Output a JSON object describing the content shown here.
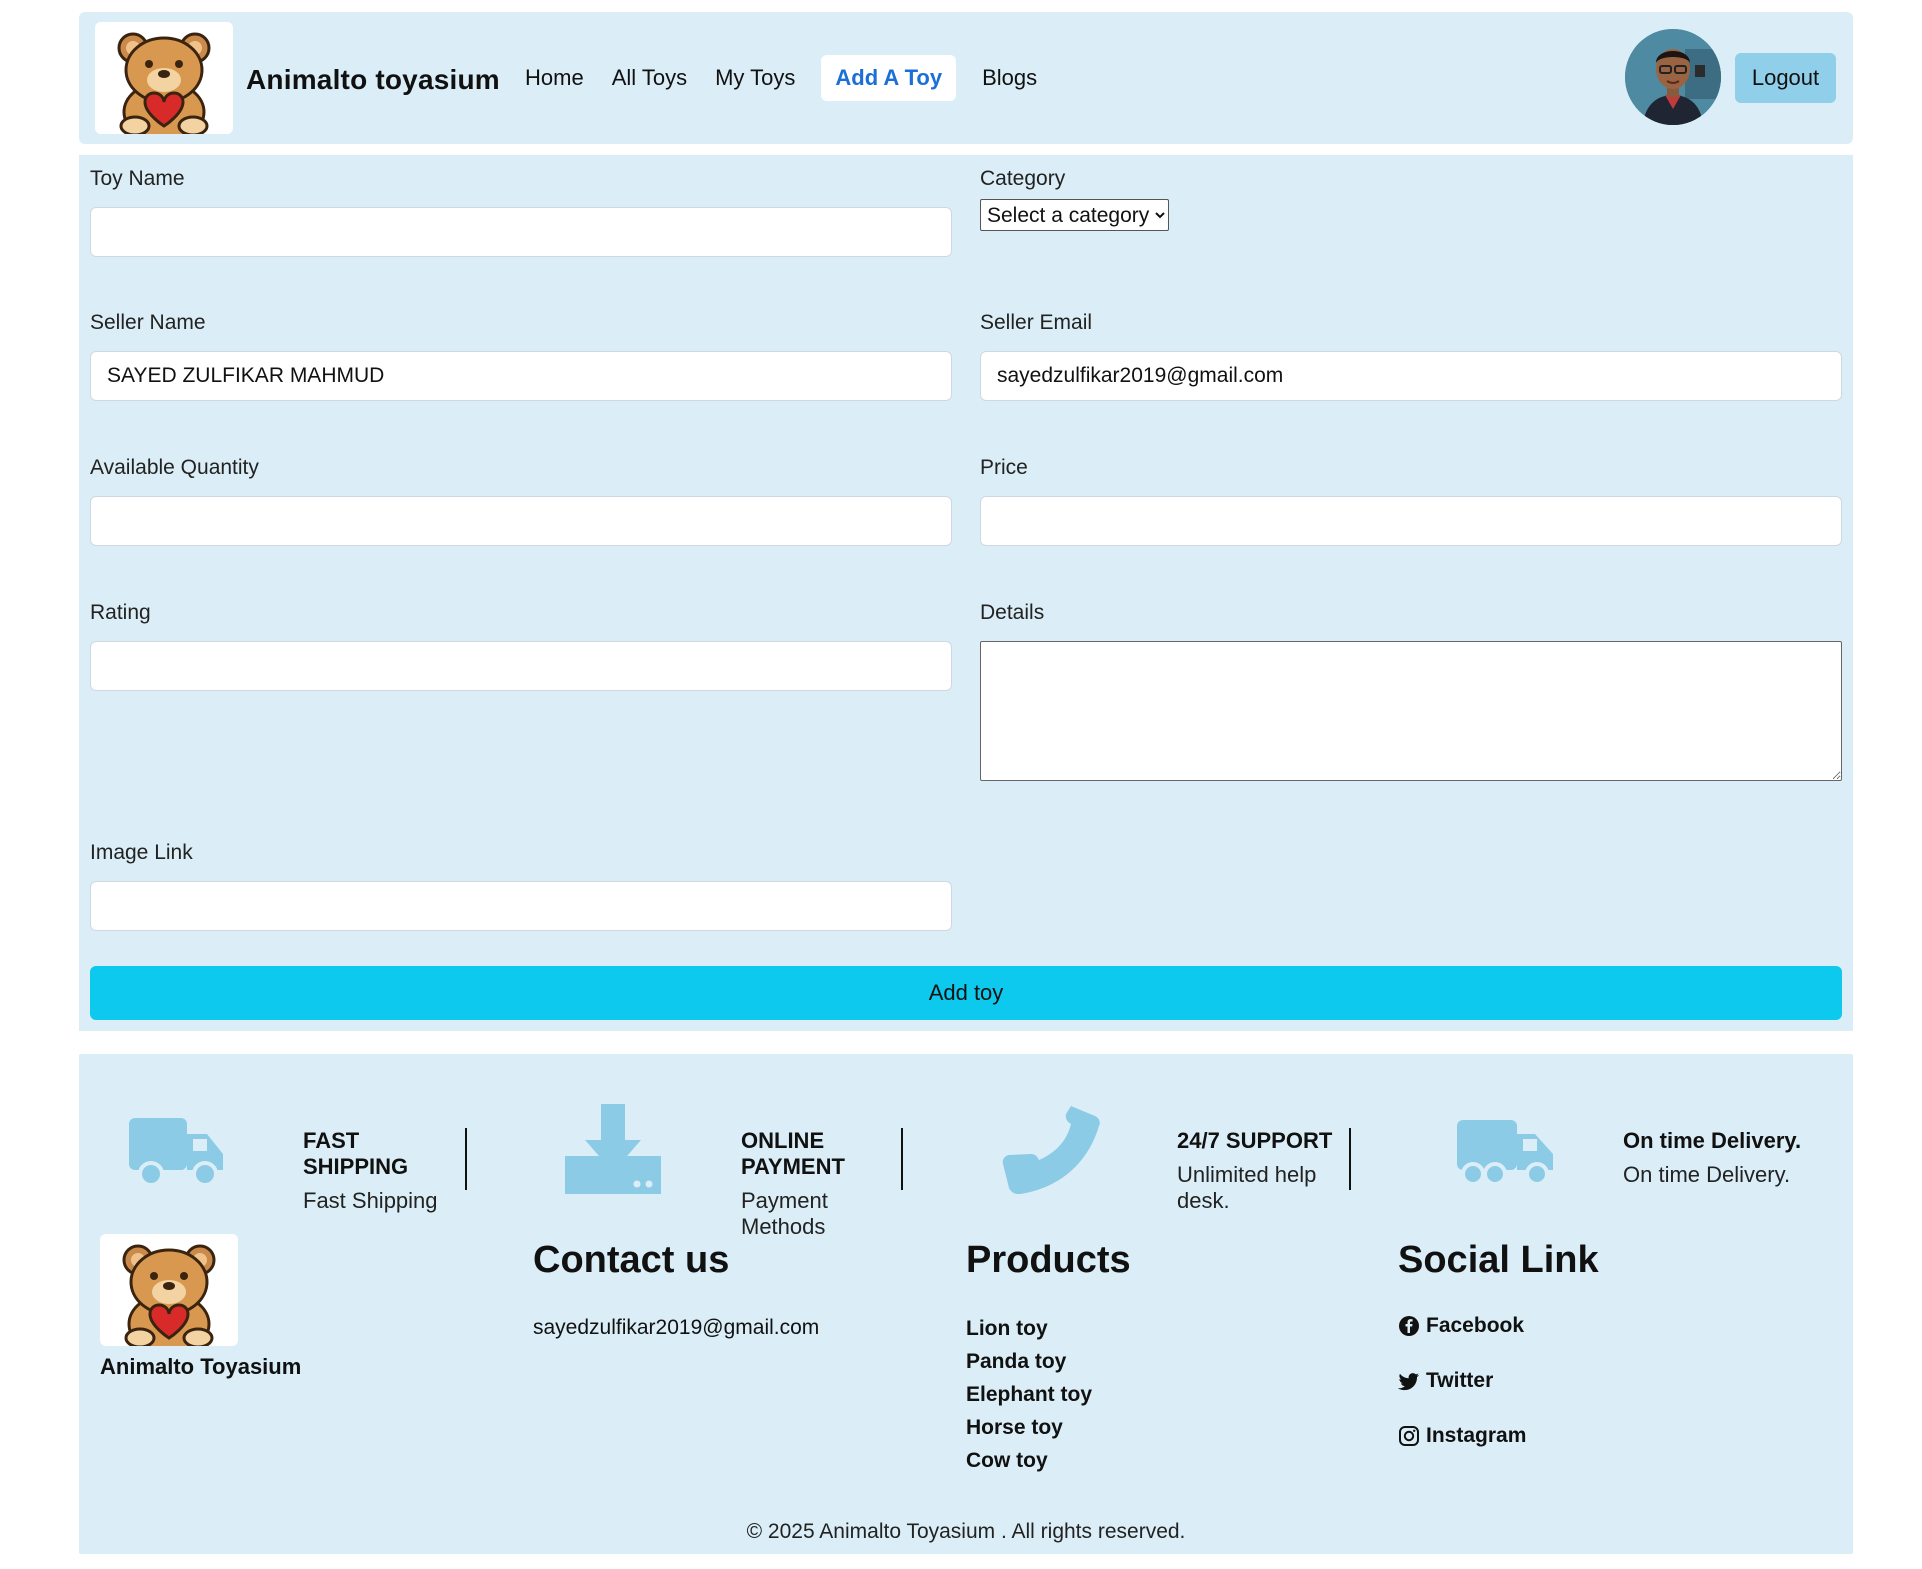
{
  "navbar": {
    "brand": "Animalto toyasium",
    "links": [
      "Home",
      "All Toys",
      "My Toys",
      "Add A Toy",
      "Blogs"
    ],
    "active_link": "Add A Toy",
    "logout_label": "Logout"
  },
  "form": {
    "toy_name": {
      "label": "Toy Name",
      "value": ""
    },
    "category": {
      "label": "Category",
      "selected": "Select a category"
    },
    "seller_name": {
      "label": "Seller Name",
      "value": "SAYED ZULFIKAR MAHMUD"
    },
    "seller_email": {
      "label": "Seller Email",
      "value": "sayedzulfikar2019@gmail.com"
    },
    "quantity": {
      "label": "Available Quantity",
      "value": ""
    },
    "price": {
      "label": "Price",
      "value": ""
    },
    "rating": {
      "label": "Rating",
      "value": ""
    },
    "details": {
      "label": "Details",
      "value": ""
    },
    "image_link": {
      "label": "Image Link",
      "value": ""
    },
    "submit_label": "Add toy"
  },
  "features": [
    {
      "icon": "truck-icon",
      "title": "FAST SHIPPING",
      "subtitle": "Fast Shipping"
    },
    {
      "icon": "download-icon",
      "title": "ONLINE PAYMENT",
      "subtitle": "Payment Methods"
    },
    {
      "icon": "phone-icon",
      "title": "24/7 SUPPORT",
      "subtitle": "Unlimited help desk."
    },
    {
      "icon": "delivery-truck-icon",
      "title": "On time Delivery.",
      "subtitle": "On time Delivery."
    }
  ],
  "footer": {
    "brand": "Animalto Toyasium",
    "contact": {
      "heading": "Contact us",
      "email": "sayedzulfikar2019@gmail.com"
    },
    "products": {
      "heading": "Products",
      "items": [
        "Lion toy",
        "Panda toy",
        "Elephant toy",
        "Horse toy",
        "Cow toy"
      ]
    },
    "social": {
      "heading": "Social Link",
      "items": [
        "Facebook",
        "Twitter",
        "Instagram"
      ]
    },
    "copyright": "© 2025 Animalto Toyasium . All rights reserved."
  },
  "colors": {
    "panel": "#dbeef7",
    "accent_button": "#0ec9ee",
    "logout_button": "#8fcfe9",
    "active_link": "#1a6fd8",
    "icon": "#8ccbe6"
  }
}
